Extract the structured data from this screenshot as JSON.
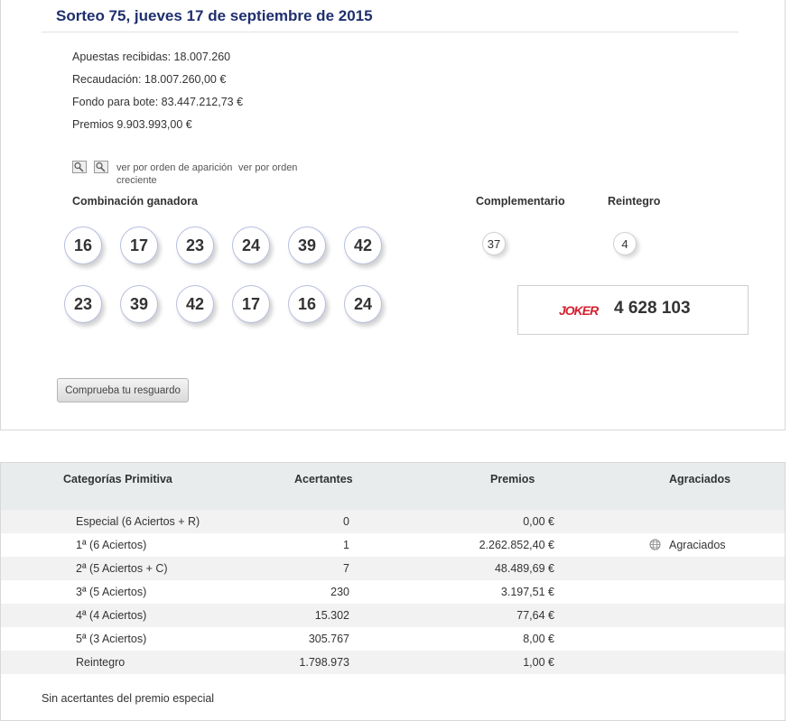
{
  "draw": {
    "title": "Sorteo 75, jueves 17 de septiembre de 2015",
    "stats": [
      "Apuestas recibidas: 18.007.260",
      "Recaudación: 18.007.260,00 €",
      "Fondo para bote: 83.447.212,73 €",
      "Premios 9.903.993,00 €"
    ],
    "view_links": {
      "appearance": "ver por orden de aparición",
      "ascending_line1": "ver por orden",
      "ascending_line2": "creciente"
    },
    "labels": {
      "winning": "Combinación ganadora",
      "complementary": "Complementario",
      "refund": "Reintegro"
    },
    "winning_sorted": [
      "16",
      "17",
      "23",
      "24",
      "39",
      "42"
    ],
    "winning_appearance": [
      "23",
      "39",
      "42",
      "17",
      "16",
      "24"
    ],
    "complementary": "37",
    "refund": "4",
    "joker": {
      "logo": "JOKER",
      "number": "4 628 103"
    },
    "check_button": "Comprueba tu resguardo"
  },
  "prizes": {
    "headers": {
      "category": "Categorías Primitiva",
      "winners": "Acertantes",
      "prizes": "Premios",
      "awarded": "Agraciados"
    },
    "rows": [
      {
        "category": "Especial (6 Aciertos + R)",
        "winners": "0",
        "prize": "0,00 €",
        "awarded": ""
      },
      {
        "category": "1ª (6 Aciertos)",
        "winners": "1",
        "prize": "2.262.852,40 €",
        "awarded": "Agraciados"
      },
      {
        "category": "2ª (5 Aciertos + C)",
        "winners": "7",
        "prize": "48.489,69 €",
        "awarded": ""
      },
      {
        "category": "3ª (5 Aciertos)",
        "winners": "230",
        "prize": "3.197,51 €",
        "awarded": ""
      },
      {
        "category": "4ª (4 Aciertos)",
        "winners": "15.302",
        "prize": "77,64 €",
        "awarded": ""
      },
      {
        "category": "5ª (3 Aciertos)",
        "winners": "305.767",
        "prize": "8,00 €",
        "awarded": ""
      },
      {
        "category": "Reintegro",
        "winners": "1.798.973",
        "prize": "1,00 €",
        "awarded": ""
      }
    ],
    "footnote": "Sin acertantes del premio especial"
  },
  "colors": {
    "title": "#1f2f6e",
    "joker": "#d4202e",
    "table_header": "#e8ecec"
  }
}
